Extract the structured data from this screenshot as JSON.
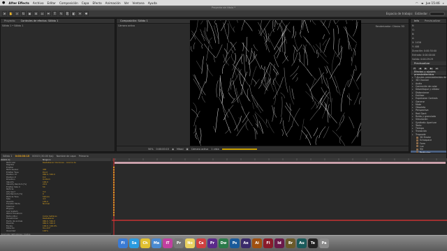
{
  "menubar": {
    "apple": "",
    "app": "After Effects",
    "items": [
      "Archivo",
      "Editar",
      "Composición",
      "Capa",
      "Efecto",
      "Animación",
      "Ver",
      "Ventana",
      "Ayuda"
    ],
    "clock": "Jue 15:46"
  },
  "window": {
    "title": "Proyecto sin título *"
  },
  "toolbar": {
    "workspace_label": "Espacio de trabajo:",
    "workspace_value": "Estándar"
  },
  "left_panel": {
    "tab_project": "Proyecto",
    "tab_effects": "Controles de efectos: Sólido 1",
    "sub": "Sólido 1 • Sólido 1"
  },
  "comp_panel": {
    "tab": "Composición: Sólido 1",
    "view_label": "Cámara activa",
    "renderer": "Renderizador: Clásico 3D",
    "bottom": {
      "zoom": "50%",
      "timecode": "0:00:00:15",
      "res": "Mitad",
      "camera": "Cámara activa",
      "views": "1 vista"
    }
  },
  "right_panel": {
    "tab_preview": "Previsualizar",
    "tab_info": "Info",
    "info_lines": [
      "R:",
      "G:",
      "B:",
      "A:",
      "X: 1456",
      "Y: 408",
      "Duración: 0:00:30:00",
      "Entrada: 0:00:00:00",
      "Salida: 0:00:29:29"
    ],
    "preview_tab": "Previsualizar",
    "effects_tab": "Efectos y ajustes preestablecidos",
    "search": "",
    "categories": [
      "* Ajustes preestablecidos de animación",
      "3D Channel",
      "Audio",
      "Corrección de color",
      "Desenfoque y nitidez",
      "Distorsionar",
      "Estilizar",
      "Expression Controls",
      "Generar",
      "Mate",
      "Obsoleto",
      "Perspectiva",
      "Red Giant",
      "Ruido y granulado",
      "Simulación",
      "Synthetic Aperture",
      "Texto",
      "Tiempo",
      "Transición",
      "Trapcode",
      "Utilidad"
    ],
    "trapcode_items": [
      "3D Stroke",
      "Echospace",
      "Form",
      "Lux",
      "Mir",
      "Particular",
      "Shine",
      "Sound Keys",
      "Starglow"
    ],
    "selected_item": "Particular"
  },
  "timeline": {
    "tab": "Sólido 1",
    "timecode": "0:00:00:15",
    "fps": "00015 (30.00 fps)",
    "col_name": "Nombre de capa",
    "col_parent": "Primario",
    "layer_name": "[Sólido 1]",
    "parent_value": "Ninguno",
    "toggle_label": "Conmutar definidores / modos",
    "rows": [
      {
        "name": "Particular",
        "value": "Restablecer  Opciones...  Acerca de"
      },
      {
        "name": "Register",
        "value": ""
      },
      {
        "name": "Emitter",
        "value": ""
      },
      {
        "name": "Particles/sec",
        "value": "400"
      },
      {
        "name": "Emitter Type",
        "value": "Point"
      },
      {
        "name": "Position XY",
        "value": "960.0, 540.0"
      },
      {
        "name": "Position Z",
        "value": "0.0"
      },
      {
        "name": "Direction",
        "value": "Uniform"
      },
      {
        "name": "Velocity",
        "value": "100.0"
      },
      {
        "name": "Velocity Random [%]",
        "value": "20.0"
      },
      {
        "name": "Emitter Size X",
        "value": "50"
      },
      {
        "name": "Particle",
        "value": ""
      },
      {
        "name": "Life [sec]",
        "value": "3.0"
      },
      {
        "name": "Life Random [%]",
        "value": "0"
      },
      {
        "name": "Particle Type",
        "value": "Sphere"
      },
      {
        "name": "Size",
        "value": "4.0"
      },
      {
        "name": "Opacity",
        "value": "100.0"
      },
      {
        "name": "Transfer Mode",
        "value": "Normal"
      },
      {
        "name": "Shading",
        "value": ""
      },
      {
        "name": "Physics",
        "value": ""
      },
      {
        "name": "Aux System",
        "value": ""
      },
      {
        "name": "World Transform",
        "value": ""
      },
      {
        "name": "Motion Blur",
        "value": "Comp Settings"
      },
      {
        "name": "Transformar",
        "value": "Restablecer"
      },
      {
        "name": "Punto de anclaje",
        "value": "960.0, 540.0"
      },
      {
        "name": "Posición",
        "value": "960.0, 540.0"
      },
      {
        "name": "Escala",
        "value": "100.0, 100.0%"
      },
      {
        "name": "Rotación",
        "value": "0x+0.0°"
      },
      {
        "name": "Opacidad",
        "value": "100%"
      }
    ]
  },
  "dock": {
    "icons": [
      "Finder",
      "Safari",
      "Chrome",
      "Mail",
      "iTunes",
      "Preferencias",
      "Notas",
      "Calendario",
      "Pr",
      "Dw",
      "Ps",
      "Ae",
      "Ai",
      "Fl",
      "Id",
      "Br",
      "Au",
      "Terminal",
      "Papelera"
    ],
    "colors": [
      "#3a7bd5",
      "#2a9be0",
      "#e0c030",
      "#4a8ad0",
      "#c040a0",
      "#777777",
      "#e8d060",
      "#d04040",
      "#5a2a8a",
      "#2a7a4a",
      "#1a5a9a",
      "#3a2a6a",
      "#a05010",
      "#8a1a2a",
      "#6a1a4a",
      "#6a5a2a",
      "#1a5a5a",
      "#222222",
      "#8a8a8a"
    ]
  }
}
